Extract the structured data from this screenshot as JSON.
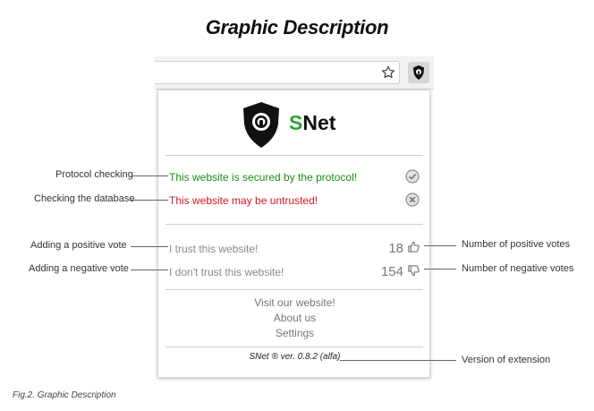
{
  "title": "Graphic Description",
  "caption": "Fig.2. Graphic Description",
  "popup": {
    "brand": {
      "s": "S",
      "rest": "Net"
    },
    "protocol_status": "This website is secured by the protocol!",
    "database_status": "This website may be untrusted!",
    "trust_label": "I trust this website!",
    "distrust_label": "I don't trust this website!",
    "positive_votes": "18",
    "negative_votes": "154",
    "links": {
      "visit": "Visit our website!",
      "about": "About us",
      "settings": "Settings"
    },
    "version": "SNet ® ver. 0.8.2 (alfa)"
  },
  "callouts": {
    "protocol_checking": "Protocol checking",
    "checking_database": "Checking the database",
    "adding_positive": "Adding a positive vote",
    "adding_negative": "Adding a negative vote",
    "number_positive": "Number of positive votes",
    "number_negative": "Number of negative votes",
    "version_of_extension": "Version of extension"
  },
  "icons": {
    "star": "star-icon",
    "extension": "snet-shield-icon",
    "protocol": "check-circle-icon",
    "database": "x-circle-icon",
    "thumbs_up": "thumbs-up-icon",
    "thumbs_down": "thumbs-down-icon"
  },
  "colors": {
    "brand_green": "#35a036",
    "secure_green": "#1a8c1a",
    "untrusted_red": "#d11a1a"
  }
}
